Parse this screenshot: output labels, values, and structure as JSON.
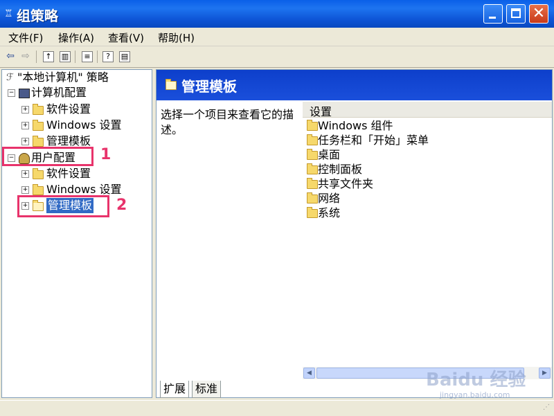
{
  "window": {
    "title": "组策略"
  },
  "menu": [
    "文件(F)",
    "操作(A)",
    "查看(V)",
    "帮助(H)"
  ],
  "tree": {
    "root": "\"本地计算机\" 策略",
    "computer": {
      "label": "计算机配置",
      "children": [
        "软件设置",
        "Windows 设置",
        "管理模板"
      ]
    },
    "user": {
      "label": "用户配置",
      "children": [
        "软件设置",
        "Windows 设置",
        "管理模板"
      ]
    }
  },
  "annotations": {
    "a1": "1",
    "a2": "2"
  },
  "right": {
    "header": "管理模板",
    "description": "选择一个项目来查看它的描述。",
    "column": "设置",
    "items": [
      "Windows 组件",
      "任务栏和「开始」菜单",
      "桌面",
      "控制面板",
      "共享文件夹",
      "网络",
      "系统"
    ]
  },
  "tabs": [
    "扩展",
    "标准"
  ],
  "watermark": {
    "line1": "Baidu 经验",
    "line2": "jingyan.baidu.com"
  },
  "colors": {
    "highlight": "#E8336B",
    "selection": "#316AC5",
    "header": "#0D3FCB"
  }
}
